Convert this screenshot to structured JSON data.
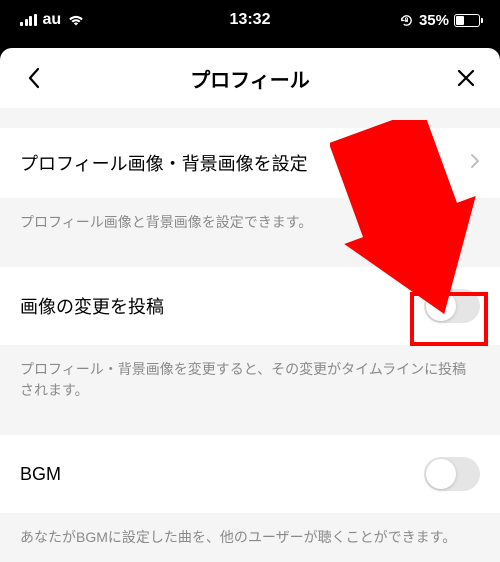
{
  "status": {
    "carrier": "au",
    "time": "13:32",
    "battery_pct": "35%"
  },
  "header": {
    "title": "プロフィール"
  },
  "rows": {
    "image_settings": {
      "label": "プロフィール画像・背景画像を設定",
      "desc": "プロフィール画像と背景画像を設定できます。"
    },
    "post_image_change": {
      "label": "画像の変更を投稿",
      "desc": "プロフィール・背景画像を変更すると、その変更がタイムラインに投稿されます。"
    },
    "bgm": {
      "label": "BGM",
      "desc": "あなたがBGMに設定した曲を、他のユーザーが聴くことができます。"
    }
  },
  "annotation": {
    "arrow_color": "#ff0000",
    "box_color": "#ff0000"
  }
}
